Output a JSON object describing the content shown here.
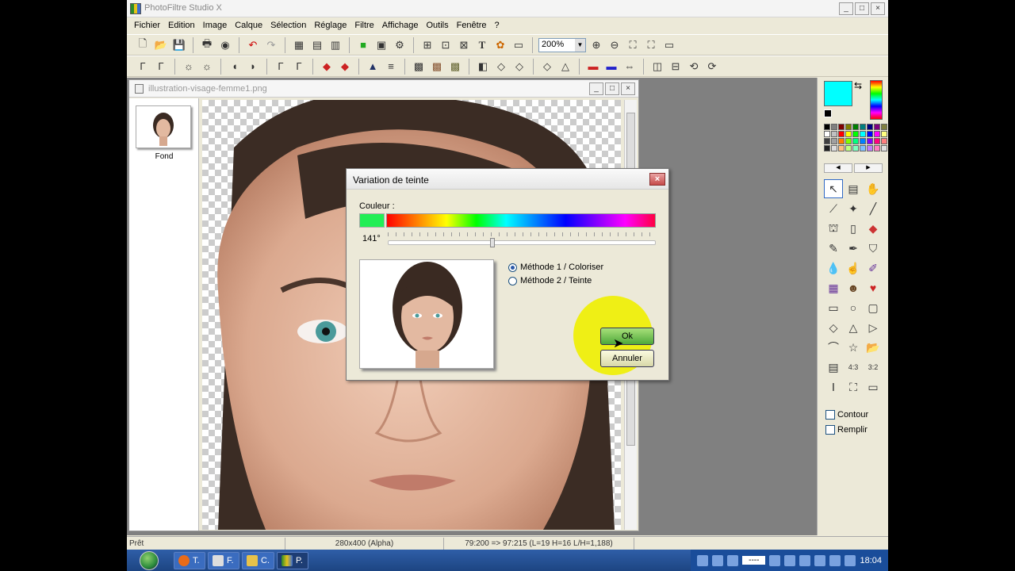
{
  "app": {
    "title": "PhotoFiltre Studio X"
  },
  "menu": [
    "Fichier",
    "Edition",
    "Image",
    "Calque",
    "Sélection",
    "Réglage",
    "Filtre",
    "Affichage",
    "Outils",
    "Fenêtre",
    "?"
  ],
  "toolbar": {
    "zoom": "200%"
  },
  "document": {
    "title": "illustration-visage-femme1.png",
    "layer_name": "Fond"
  },
  "dialog": {
    "title": "Variation de teinte",
    "color_label": "Couleur :",
    "current_color": "#22ee55",
    "angle": "141°",
    "hue_value": 141,
    "method1": "Méthode 1 / Coloriser",
    "method2": "Méthode 2 / Teinte",
    "ok": "Ok",
    "cancel": "Annuler"
  },
  "panel": {
    "fg_color": "#00ffff",
    "bg_color": "#000000",
    "contour": "Contour",
    "remplir": "Remplir"
  },
  "palette": [
    "#000000",
    "#7f7f7f",
    "#7f0000",
    "#7f7f00",
    "#007f00",
    "#007f7f",
    "#00007f",
    "#7f007f",
    "#7f7f3f",
    "#ffffff",
    "#c0c0c0",
    "#ff0000",
    "#ffff00",
    "#00ff00",
    "#00ffff",
    "#0000ff",
    "#ff00ff",
    "#ffff7f",
    "#3f3f3f",
    "#a0a0a0",
    "#ff7f00",
    "#7fff00",
    "#00ff7f",
    "#007fff",
    "#7f00ff",
    "#ff007f",
    "#ff7f7f",
    "#202020",
    "#dcdcdc",
    "#ffbf7f",
    "#bfff7f",
    "#7fffbf",
    "#7fbfff",
    "#bf7fff",
    "#ff7fbf",
    "#e0e0e0"
  ],
  "status": {
    "state": "Prêt",
    "size": "280x400 (Alpha)",
    "coords": "79:200 => 97:215 (L=19  H=16  L/H=1,188)"
  },
  "taskbar": {
    "items": [
      "T.",
      "F.",
      "C.",
      "P."
    ],
    "time": "18:04",
    "input_box": "----"
  }
}
